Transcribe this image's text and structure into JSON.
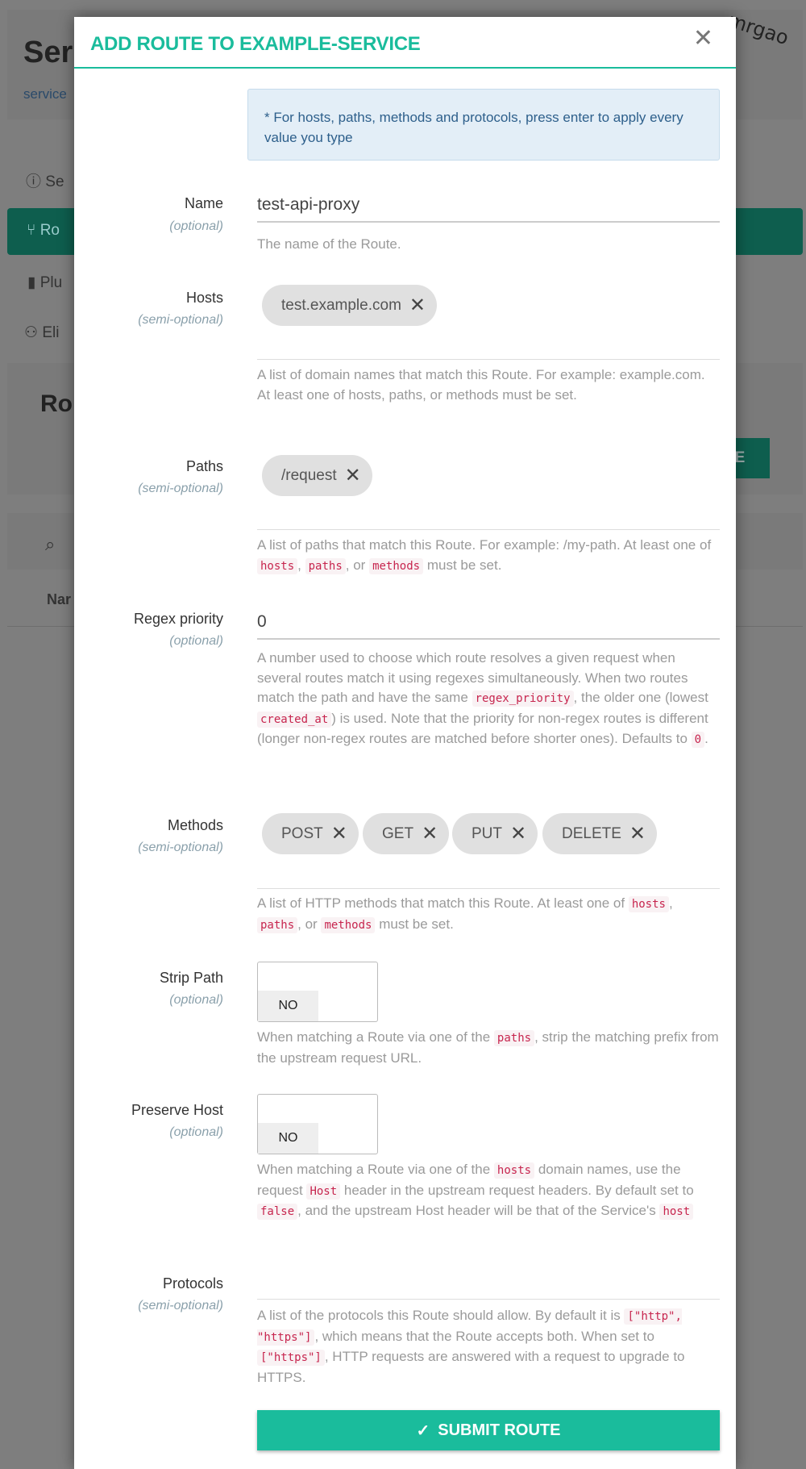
{
  "background": {
    "page_title_fragment": "Ser",
    "breadcrumb_fragment": "service",
    "nav": [
      {
        "icon": "info-icon",
        "label": "Se"
      },
      {
        "icon": "routes-icon",
        "label": "Ro",
        "active": true
      },
      {
        "icon": "plug-icon",
        "label": "Plu"
      },
      {
        "icon": "users-icon",
        "label": "Eli"
      }
    ],
    "section_title_fragment": "Ro",
    "add_button_fragment": "TE",
    "table_header_fragment": "Nar"
  },
  "watermark": "mrgao",
  "modal": {
    "title": "ADD ROUTE TO EXAMPLE-SERVICE",
    "close": "✕",
    "info": "* For hosts, paths, methods and protocols, press enter to apply every value you type",
    "fields": {
      "name": {
        "label": "Name",
        "qualifier": "(optional)",
        "value": "test-api-proxy",
        "help": "The name of the Route."
      },
      "hosts": {
        "label": "Hosts",
        "qualifier": "(semi-optional)",
        "chips": [
          "test.example.com"
        ],
        "help": "A list of domain names that match this Route. For example: example.com. At least one of hosts, paths, or methods must be set."
      },
      "paths": {
        "label": "Paths",
        "qualifier": "(semi-optional)",
        "chips": [
          "/request"
        ],
        "help_a": "A list of paths that match this Route. For example: /my-path. At least one of",
        "c1": "hosts",
        "c2": "paths",
        "c3": "methods",
        "sep1": ",",
        "sep2": ", or",
        "help_b": "must be set."
      },
      "regex": {
        "label": "Regex priority",
        "qualifier": "(optional)",
        "value": "0",
        "h1": "A number used to choose which route resolves a given request when several routes match it using regexes simultaneously. When two routes match the path and have the same",
        "c1": "regex_priority",
        "h2": ", the older one (lowest",
        "c2": "created_at",
        "h3": ") is used. Note that the priority for non-regex routes is different (longer non-regex routes are matched before shorter ones). Defaults to",
        "c3": "0",
        "h4": "."
      },
      "methods": {
        "label": "Methods",
        "qualifier": "(semi-optional)",
        "chips": [
          "POST",
          "GET",
          "PUT",
          "DELETE"
        ],
        "help_a": "A list of HTTP methods that match this Route. At least one of",
        "c1": "hosts",
        "c2": "paths",
        "c3": "methods",
        "sep1": ",",
        "sep2": ", or",
        "help_b": "must be set."
      },
      "strip_path": {
        "label": "Strip Path",
        "qualifier": "(optional)",
        "value": "NO",
        "h1": "When matching a Route via one of the",
        "c1": "paths",
        "h2": ", strip the matching prefix from the upstream request URL."
      },
      "preserve_host": {
        "label": "Preserve Host",
        "qualifier": "(optional)",
        "value": "NO",
        "h1": "When matching a Route via one of the",
        "c1": "hosts",
        "h2": "domain names, use the request",
        "c2": "Host",
        "h3": "header in the upstream request headers. By default set to",
        "c3": "false",
        "h4": ", and the upstream Host header will be that of the Service's",
        "c4": "host"
      },
      "protocols": {
        "label": "Protocols",
        "qualifier": "(semi-optional)",
        "h1": "A list of the protocols this Route should allow. By default it is",
        "c1": "[\"http\", \"https\"]",
        "h2": ", which means that the Route accepts both. When set to",
        "c2": "[\"https\"]",
        "h3": ", HTTP requests are answered with a request to upgrade to HTTPS."
      }
    },
    "submit": "SUBMIT ROUTE",
    "remove_icon": "✕"
  },
  "colors": {
    "accent": "#1abc9c",
    "active_nav": "#0e5e4e",
    "code": "#c7254e"
  }
}
